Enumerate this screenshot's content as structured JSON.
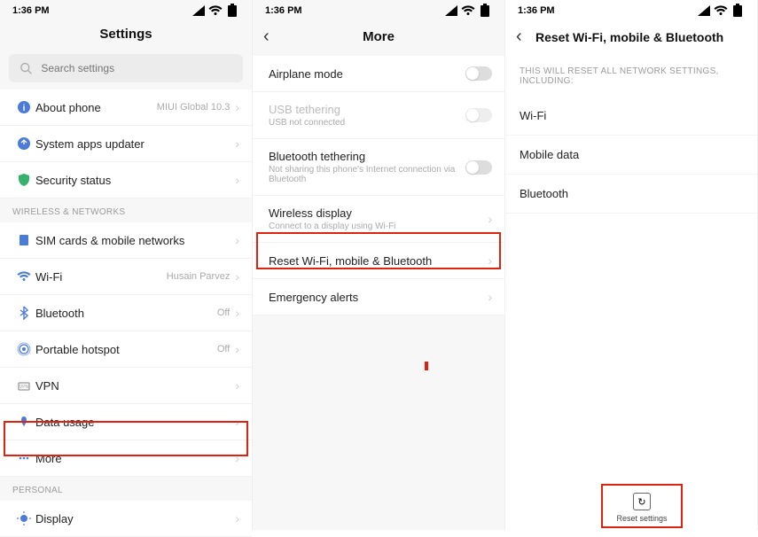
{
  "status": {
    "time": "1:36 PM"
  },
  "screen1": {
    "title": "Settings",
    "search_placeholder": "Search settings",
    "about": {
      "label": "About phone",
      "value": "MIUI Global 10.3"
    },
    "updater": {
      "label": "System apps updater"
    },
    "security": {
      "label": "Security status"
    },
    "section_wireless": "WIRELESS & NETWORKS",
    "sim": {
      "label": "SIM cards & mobile networks"
    },
    "wifi": {
      "label": "Wi-Fi",
      "value": "Husain Parvez"
    },
    "bluetooth": {
      "label": "Bluetooth",
      "value": "Off"
    },
    "hotspot": {
      "label": "Portable hotspot",
      "value": "Off"
    },
    "vpn": {
      "label": "VPN"
    },
    "data": {
      "label": "Data usage"
    },
    "more": {
      "label": "More"
    },
    "section_personal": "PERSONAL",
    "display": {
      "label": "Display"
    }
  },
  "screen2": {
    "title": "More",
    "airplane": {
      "label": "Airplane mode"
    },
    "usb": {
      "label": "USB tethering",
      "sub": "USB not connected"
    },
    "bt_tether": {
      "label": "Bluetooth tethering",
      "sub": "Not sharing this phone's Internet connection via Bluetooth"
    },
    "wdisplay": {
      "label": "Wireless display",
      "sub": "Connect to a display using Wi-Fi"
    },
    "reset": {
      "label": "Reset Wi-Fi, mobile & Bluetooth"
    },
    "emergency": {
      "label": "Emergency alerts"
    }
  },
  "screen3": {
    "title": "Reset Wi-Fi, mobile & Bluetooth",
    "info": "THIS WILL RESET ALL NETWORK SETTINGS, INCLUDING:",
    "item_wifi": "Wi-Fi",
    "item_mobile": "Mobile data",
    "item_bt": "Bluetooth",
    "reset_button": "Reset settings"
  }
}
